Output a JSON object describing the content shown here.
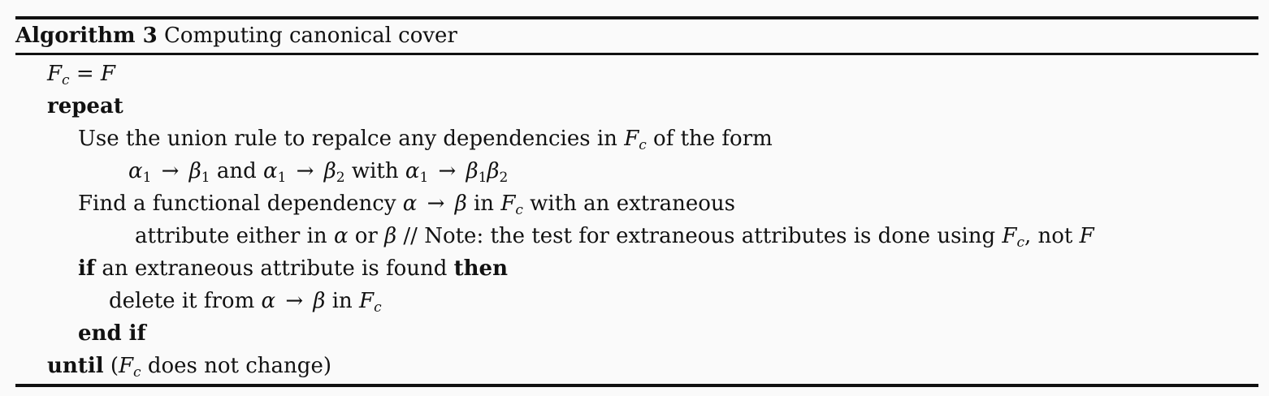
{
  "algorithm": {
    "label": "Algorithm 3",
    "title": "Computing canonical cover"
  },
  "symbols": {
    "F": "F",
    "c": "c",
    "alpha": "α",
    "beta": "β",
    "one": "1",
    "two": "2",
    "arrow": "→",
    "eq": "="
  },
  "lines": {
    "init_eq": "=",
    "repeat_kw": "repeat",
    "union_text": "Use the union rule to repalce any dependencies in",
    "union_tail": "of the form",
    "union_and": "and",
    "union_with": "with",
    "find_text": "Find a functional dependency",
    "find_in": "in",
    "find_tail": "with an extraneous",
    "attr_text": "attribute either in",
    "attr_or": "or",
    "attr_note": "// Note: the test for extraneous attributes is done using",
    "attr_not": ", not",
    "if_kw": "if",
    "if_text": "an extraneous attribute is found",
    "then_kw": "then",
    "delete_text": "delete it from",
    "delete_in": "in",
    "endif_kw": "end if",
    "until_kw": "until",
    "until_open": "(",
    "until_text": "does not change)"
  }
}
